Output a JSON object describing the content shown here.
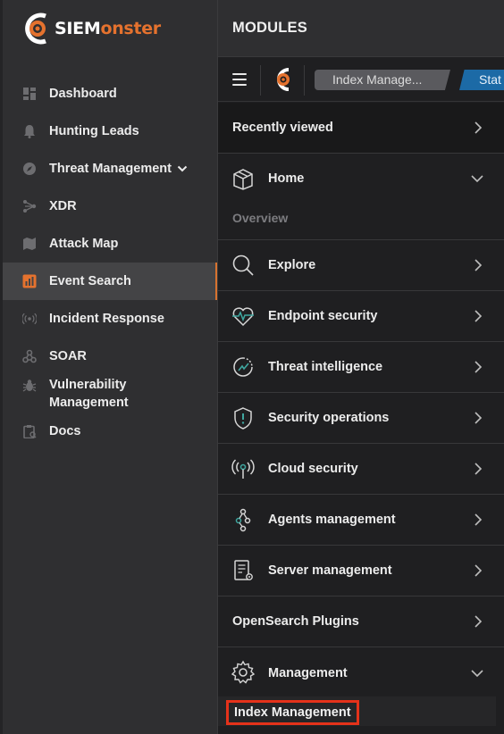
{
  "brand": {
    "logo_word_white": "SIEM",
    "logo_word_orange": "onster",
    "accent": "#e5722e"
  },
  "sidebar": {
    "items": [
      {
        "label": "Dashboard",
        "icon": "dashboard-icon"
      },
      {
        "label": "Hunting Leads",
        "icon": "bell-icon"
      },
      {
        "label": "Threat Management",
        "icon": "compass-icon",
        "has_dropdown": true
      },
      {
        "label": "XDR",
        "icon": "network-icon"
      },
      {
        "label": "Attack Map",
        "icon": "map-icon"
      },
      {
        "label": "Event Search",
        "icon": "chart-icon",
        "active": true
      },
      {
        "label": "Incident Response",
        "icon": "broadcast-icon"
      },
      {
        "label": "SOAR",
        "icon": "webhook-icon"
      },
      {
        "label": "Vulnerability Management",
        "line1": "Vulnerability",
        "line2": "Management",
        "icon": "bug-icon"
      },
      {
        "label": "Docs",
        "icon": "clipboard-icon"
      }
    ]
  },
  "modules": {
    "title": "MODULES",
    "breadcrumb_current": "Index Manage...",
    "breadcrumb_next": "Stat",
    "recently_viewed": "Recently viewed",
    "home": {
      "label": "Home",
      "sub": "Overview"
    },
    "sections": [
      {
        "label": "Explore",
        "icon": "search-icon"
      },
      {
        "label": "Endpoint security",
        "icon": "heartbeat-icon"
      },
      {
        "label": "Threat intelligence",
        "icon": "radar-icon"
      },
      {
        "label": "Security operations",
        "icon": "shield-icon"
      },
      {
        "label": "Cloud security",
        "icon": "antenna-icon"
      },
      {
        "label": "Agents management",
        "icon": "nodes-icon"
      },
      {
        "label": "Server management",
        "icon": "server-doc-icon"
      }
    ],
    "opensearch_plugins": "OpenSearch Plugins",
    "management": {
      "label": "Management",
      "sub": "Index Management"
    }
  }
}
